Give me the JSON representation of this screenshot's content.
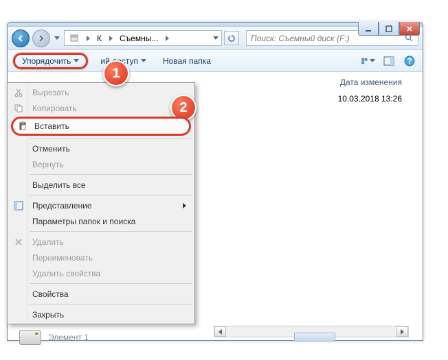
{
  "titlebar": {
    "min": "",
    "max": "",
    "close": ""
  },
  "nav": {
    "breadcrumb_segments": [
      "К",
      "Съемны..."
    ],
    "search_placeholder": "Поиск: Съемный диск (F:)"
  },
  "toolbar": {
    "organize": "Упорядочить",
    "share": "ий доступ",
    "new_folder": "Новая папка"
  },
  "columns": {
    "date_modified": "Дата изменения"
  },
  "rows": [
    {
      "date": "10.03.2018 13:26"
    }
  ],
  "menu": {
    "items": [
      {
        "label": "Вырезать",
        "disabled": true,
        "icon": "cut-icon"
      },
      {
        "label": "Копировать",
        "disabled": true,
        "icon": "copy-icon"
      },
      {
        "label": "Вставить",
        "disabled": false,
        "icon": "paste-icon",
        "highlight": true
      },
      {
        "sep": true
      },
      {
        "label": "Отменить",
        "disabled": false
      },
      {
        "label": "Вернуть",
        "disabled": true
      },
      {
        "sep": true
      },
      {
        "label": "Выделить все",
        "disabled": false
      },
      {
        "sep": true
      },
      {
        "label": "Представление",
        "disabled": false,
        "icon": "layout-icon",
        "submenu": true
      },
      {
        "label": "Параметры папок и поиска",
        "disabled": false
      },
      {
        "sep": true
      },
      {
        "label": "Удалить",
        "disabled": true,
        "icon": "delete-icon"
      },
      {
        "label": "Переименовать",
        "disabled": true
      },
      {
        "label": "Удалить свойства",
        "disabled": true
      },
      {
        "sep": true
      },
      {
        "label": "Свойства",
        "disabled": false
      },
      {
        "sep": true
      },
      {
        "label": "Закрыть",
        "disabled": false
      }
    ]
  },
  "footer": {
    "elements_label": "Элемент 1"
  },
  "callouts": {
    "one": "1",
    "two": "2"
  }
}
